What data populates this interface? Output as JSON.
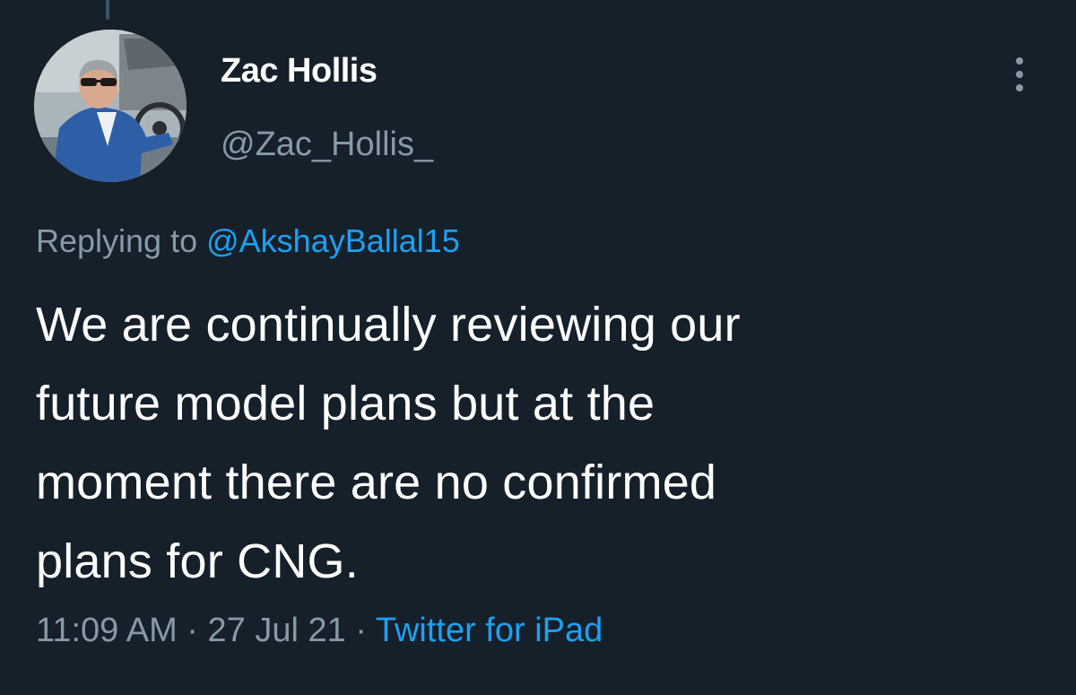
{
  "author": {
    "display_name": "Zac Hollis",
    "handle": "@Zac_Hollis_",
    "avatar_icon": "profile-photo"
  },
  "menu": {
    "icon": "more-vertical-icon"
  },
  "reply": {
    "prefix": "Replying to ",
    "mention": "@AkshayBallal15"
  },
  "tweet": {
    "lines": [
      "We are continually reviewing our",
      "future model plans but at the",
      "moment there are no confirmed",
      "plans for CNG."
    ]
  },
  "meta": {
    "time": "11:09 AM",
    "separator": " · ",
    "date": "27 Jul 21",
    "source": "Twitter for iPad"
  },
  "colors": {
    "background": "#15202b",
    "text_primary": "#ffffff",
    "text_secondary": "#8899a6",
    "link": "#1da1f2"
  }
}
